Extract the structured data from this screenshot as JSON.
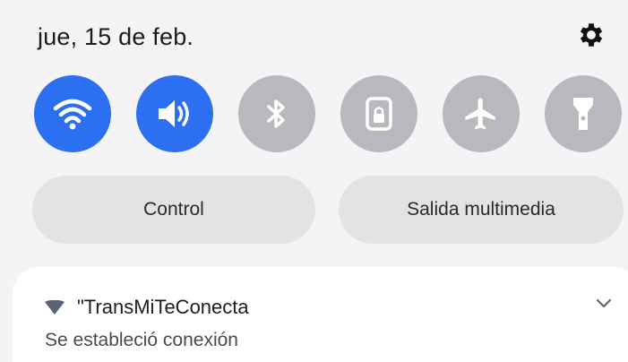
{
  "header": {
    "date": "jue, 15 de feb.",
    "settings_icon": "gear-icon"
  },
  "quick_toggles": [
    {
      "name": "wifi",
      "icon": "wifi-icon",
      "state": "on"
    },
    {
      "name": "sound",
      "icon": "sound-icon",
      "state": "on"
    },
    {
      "name": "bluetooth",
      "icon": "bluetooth-icon",
      "state": "off"
    },
    {
      "name": "screen-lock",
      "icon": "lock-icon",
      "state": "off"
    },
    {
      "name": "airplane-mode",
      "icon": "airplane-icon",
      "state": "off"
    },
    {
      "name": "flashlight",
      "icon": "flashlight-icon",
      "state": "off"
    }
  ],
  "buttons": {
    "control_label": "Control",
    "media_output_label": "Salida multimedia"
  },
  "notification": {
    "title": "\"TransMiTeConecta",
    "body": "Se estableció conexión"
  },
  "colors": {
    "accent_on": "#2c6ff0",
    "toggle_off": "#b9b9bd",
    "background": "#f4f4f6",
    "pill": "#e3e3e6"
  }
}
